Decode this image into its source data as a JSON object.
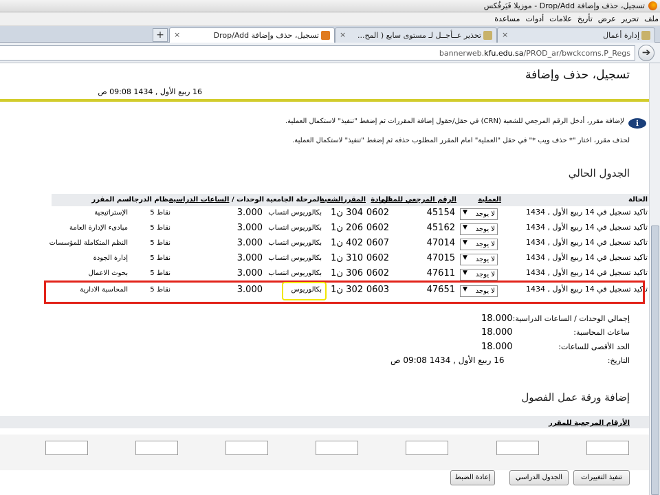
{
  "window": {
    "title": "تسجيل، حذف وإضافة Drop/Add - موزيلا فَيَرفُكس"
  },
  "menu": [
    "ملف",
    "تحرير",
    "عرض",
    "تأريخ",
    "علامات",
    "أدوات",
    "مساعدة"
  ],
  "tabs": [
    {
      "label": "إدارة أعمال"
    },
    {
      "label": "تحذير عــأجــل لـ مستوى سابع ( المح..."
    },
    {
      "label": "تسجيل، حذف وإضافة Drop/Add"
    }
  ],
  "new_tab": "+",
  "tab_close": "×",
  "url": {
    "prefix": "bannerweb.",
    "domain": "kfu.edu.sa",
    "suffix": "/PROD_ar/bwckcoms.P_Regs"
  },
  "page": {
    "title": "تسجيل، حذف وإضافة",
    "date": "16 ربيع الأول , 1434 09:08 ص",
    "info_line1": "لإضافة مقرر، أدخل الرقم المرجعي للشعبة (CRN) في حقل/حقول إضافة المقررات ثم إضغط \"تنفيذ\" لاستكمال العملية.",
    "info_line2": "لحذف مقرر، اختار \"* حذف ويب *\" في حقل \"العملية\" امام المقرر المطلوب حذفه ثم إضغط \"تنفيذ\" لاستكمال العملية.",
    "info_icon": "i"
  },
  "schedule": {
    "heading": "الجدول الحالي",
    "headers": {
      "status": "الحالة",
      "action": "العملية",
      "crn": "الرقم المرجعي للمقرر",
      "subject": "المادة",
      "course": "المقرر",
      "section": "الشعبة",
      "level": "المرحلة الجامعية",
      "units_a": "الوحدات",
      "units_b": "/",
      "units_c": "الساعات الدراسية",
      "grade_mode": "نظام الدرجات",
      "course_name": "اسم المقرر"
    },
    "rows": [
      {
        "status": "تاكيد تسجيل في 14 ربيع الأول , 1434",
        "action": "لا يوجد",
        "crn": "45154",
        "subject": "0602",
        "course": "304",
        "section": "ن1",
        "level": "بكالوريوس انتساب",
        "units": "3.000",
        "grade": "نقاط 5",
        "name": "الإستراتيجية"
      },
      {
        "status": "تاكيد تسجيل في 14 ربيع الأول , 1434",
        "action": "لا يوجد",
        "crn": "45162",
        "subject": "0602",
        "course": "206",
        "section": "ن1",
        "level": "بكالوريوس انتساب",
        "units": "3.000",
        "grade": "نقاط 5",
        "name": "مبادىء الإدارة العامة"
      },
      {
        "status": "تاكيد تسجيل في 14 ربيع الأول , 1434",
        "action": "لا يوجد",
        "crn": "47014",
        "subject": "0607",
        "course": "402",
        "section": "ن1",
        "level": "بكالوريوس انتساب",
        "units": "3.000",
        "grade": "نقاط 5",
        "name": "النظم المتكاملة للمؤسسات"
      },
      {
        "status": "تاكيد تسجيل في 14 ربيع الأول , 1434",
        "action": "لا يوجد",
        "crn": "47015",
        "subject": "0602",
        "course": "310",
        "section": "ن1",
        "level": "بكالوريوس انتساب",
        "units": "3.000",
        "grade": "نقاط 5",
        "name": "إدارة الجودة"
      },
      {
        "status": "تاكيد تسجيل في 14 ربيع الأول , 1434",
        "action": "لا يوجد",
        "crn": "47611",
        "subject": "0602",
        "course": "306",
        "section": "ن1",
        "level": "بكالوريوس انتساب",
        "units": "3.000",
        "grade": "نقاط 5",
        "name": "بحوث الاعمال"
      },
      {
        "status": "تاكيد تسجيل في 14 ربيع الأول , 1434",
        "action": "لا يوجد",
        "crn": "47651",
        "subject": "0603",
        "course": "302",
        "section": "ن1",
        "level": "بكالوريوس",
        "units": "3.000",
        "grade": "نقاط 5",
        "name": "المحاسبة الادارية"
      }
    ]
  },
  "summary": {
    "total_label": "إجمالي الوحدات / الساعات الدراسية:",
    "total_value": "18.000",
    "billing_label": "ساعات المحاسبة:",
    "billing_value": "18.000",
    "max_label": "الحد الأقصى للساعات:",
    "max_value": "18.000",
    "date_label": "التاريخ:",
    "date_value": "16 ربيع الأول , 1434 09:08 ص"
  },
  "add_section": {
    "heading": "إضافة ورقة عمل الفصول",
    "crn_header": "الأرقام المرجعية للمقرر",
    "crn_values": [
      "",
      "",
      "",
      "",
      "",
      "",
      ""
    ]
  },
  "buttons": {
    "submit": "تنفيذ التغييرات",
    "schedule": "الجدول الدراسي",
    "reset": "إعادة الضبط"
  }
}
